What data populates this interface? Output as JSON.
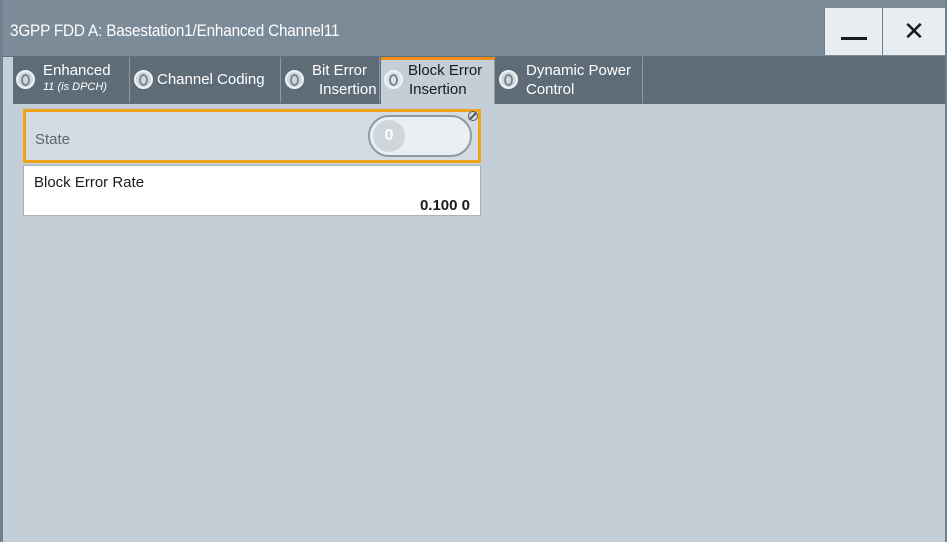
{
  "window": {
    "title": "3GPP FDD A: Basestation1/Enhanced Channel11",
    "minimize_icon": "minimize-icon",
    "close_icon": "close-icon"
  },
  "tabs": [
    {
      "label": "Enhanced",
      "sublabel": "11 (is DPCH)",
      "active": false
    },
    {
      "label": "Channel Coding",
      "active": false
    },
    {
      "label": "Bit Error",
      "label2": "Insertion",
      "active": false
    },
    {
      "label": "Block Error",
      "label2": "Insertion",
      "active": true
    },
    {
      "label": "Dynamic Power",
      "label2": "Control",
      "active": false
    }
  ],
  "state": {
    "label": "State",
    "toggle_value": "0",
    "status_icon": "not-allowed-icon"
  },
  "block_error_rate": {
    "label": "Block Error Rate",
    "value": "0.100 0"
  },
  "colors": {
    "titlebar": "#7b8b98",
    "tabstrip": "#5e6c78",
    "panel_bg": "#c3ced6",
    "accent": "#f28c1c"
  }
}
